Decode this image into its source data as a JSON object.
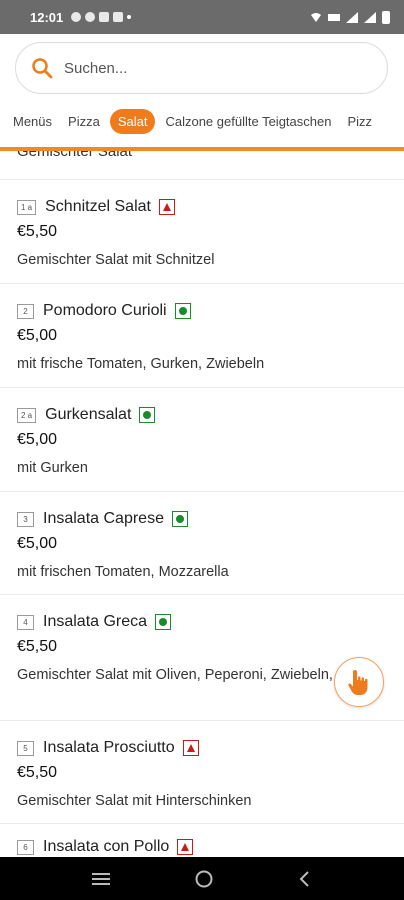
{
  "status_bar": {
    "time": "12:01"
  },
  "search": {
    "placeholder": "Suchen..."
  },
  "tabs": [
    {
      "label": "Menüs",
      "active": false
    },
    {
      "label": "Pizza",
      "active": false
    },
    {
      "label": "Salat",
      "active": true
    },
    {
      "label": "Calzone gefüllte Teigtaschen",
      "active": false
    },
    {
      "label": "Pizz",
      "active": false
    }
  ],
  "previous_item_cut": "Gemischter Salat",
  "items": [
    {
      "num": "1 a",
      "name": "Schnitzel Salat",
      "badge": "meat",
      "price": "€5,50",
      "desc": "Gemischter Salat mit Schnitzel"
    },
    {
      "num": "2",
      "name": "Pomodoro Curioli",
      "badge": "veg",
      "price": "€5,00",
      "desc": "mit frische Tomaten, Gurken, Zwiebeln"
    },
    {
      "num": "2 a",
      "name": "Gurkensalat",
      "badge": "veg",
      "price": "€5,00",
      "desc": "mit Gurken"
    },
    {
      "num": "3",
      "name": "Insalata Caprese",
      "badge": "veg",
      "price": "€5,00",
      "desc": "mit frischen Tomaten, Mozzarella"
    },
    {
      "num": "4",
      "name": "Insalata Greca",
      "badge": "veg",
      "price": "€5,50",
      "desc": "Gemischter Salat mit Oliven, Peperoni, Zwiebeln, Feta"
    },
    {
      "num": "5",
      "name": "Insalata Prosciutto",
      "badge": "meat",
      "price": "€5,50",
      "desc": "Gemischter Salat mit Hinterschinken"
    },
    {
      "num": "6",
      "name": "Insalata con Pollo",
      "badge": "meat",
      "price": "",
      "desc": ""
    }
  ],
  "colors": {
    "accent": "#ee7c1c",
    "veg": "#1a8a2a",
    "meat": "#cc1b1b"
  },
  "icons": {
    "search": "search-icon",
    "fab": "hand-pointer-icon",
    "nav": [
      "menu-icon",
      "home-icon",
      "back-icon"
    ]
  }
}
